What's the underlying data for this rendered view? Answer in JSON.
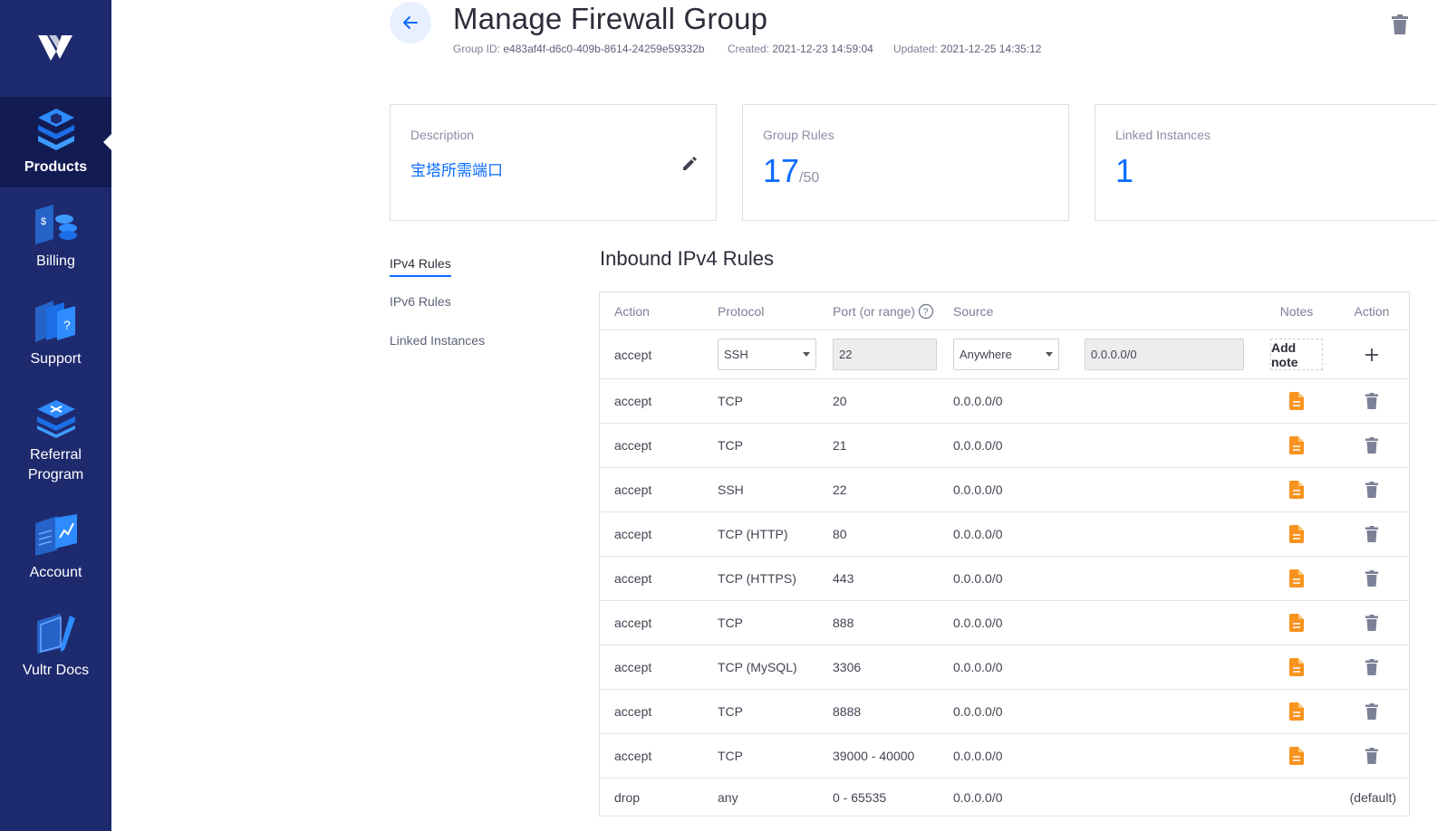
{
  "sidebar": {
    "items": [
      {
        "label": "Products",
        "icon": "products-icon",
        "active": true
      },
      {
        "label": "Billing",
        "icon": "billing-icon"
      },
      {
        "label": "Support",
        "icon": "support-icon"
      },
      {
        "label": "Referral Program",
        "icon": "referral-icon"
      },
      {
        "label": "Account",
        "icon": "account-icon"
      },
      {
        "label": "Vultr Docs",
        "icon": "docs-icon"
      }
    ]
  },
  "header": {
    "title": "Manage Firewall Group",
    "group_id_label": "Group ID:",
    "group_id": "e483af4f-d6c0-409b-8614-24259e59332b",
    "created_label": "Created:",
    "created": "2021-12-23 14:59:04",
    "updated_label": "Updated:",
    "updated": "2021-12-25 14:35:12"
  },
  "cards": {
    "description_label": "Description",
    "description_value": "宝塔所需端口",
    "rules_label": "Group Rules",
    "rules_count": "17",
    "rules_max": "/50",
    "linked_label": "Linked Instances",
    "linked_count": "1"
  },
  "subnav": [
    "IPv4 Rules",
    "IPv6 Rules",
    "Linked Instances"
  ],
  "section_title": "Inbound IPv4 Rules",
  "table": {
    "headers": {
      "action": "Action",
      "protocol": "Protocol",
      "port": "Port (or range)",
      "source": "Source",
      "notes": "Notes",
      "action2": "Action"
    },
    "input_row": {
      "action": "accept",
      "protocol": "SSH",
      "port": "22",
      "source": "Anywhere",
      "source_ip": "0.0.0.0/0",
      "add_note": "Add note"
    },
    "rows": [
      {
        "action": "accept",
        "protocol": "TCP",
        "port": "20",
        "source": "0.0.0.0/0"
      },
      {
        "action": "accept",
        "protocol": "TCP",
        "port": "21",
        "source": "0.0.0.0/0"
      },
      {
        "action": "accept",
        "protocol": "SSH",
        "port": "22",
        "source": "0.0.0.0/0"
      },
      {
        "action": "accept",
        "protocol": "TCP (HTTP)",
        "port": "80",
        "source": "0.0.0.0/0"
      },
      {
        "action": "accept",
        "protocol": "TCP (HTTPS)",
        "port": "443",
        "source": "0.0.0.0/0"
      },
      {
        "action": "accept",
        "protocol": "TCP",
        "port": "888",
        "source": "0.0.0.0/0"
      },
      {
        "action": "accept",
        "protocol": "TCP (MySQL)",
        "port": "3306",
        "source": "0.0.0.0/0"
      },
      {
        "action": "accept",
        "protocol": "TCP",
        "port": "8888",
        "source": "0.0.0.0/0"
      },
      {
        "action": "accept",
        "protocol": "TCP",
        "port": "39000 - 40000",
        "source": "0.0.0.0/0"
      }
    ],
    "default_row": {
      "action": "drop",
      "protocol": "any",
      "port": "0 - 65535",
      "source": "0.0.0.0/0",
      "note": "(default)"
    }
  },
  "colors": {
    "sidebar": "#1e2a6e",
    "sidebar_active": "#131c52",
    "accent": "#0a6cff",
    "note_icon": "#f7931e",
    "trash_icon": "#7c8197"
  }
}
